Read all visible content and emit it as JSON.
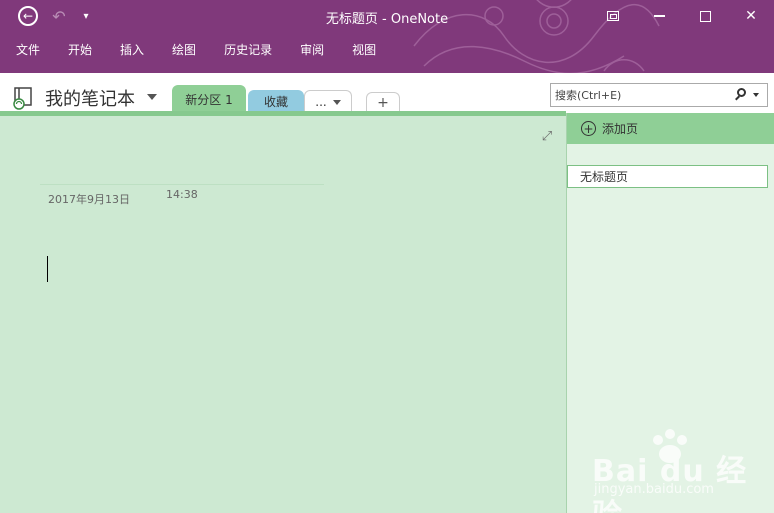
{
  "window": {
    "title": "无标题页 - OneNote"
  },
  "ribbon": {
    "menus": [
      "文件",
      "开始",
      "插入",
      "绘图",
      "历史记录",
      "审阅",
      "视图"
    ]
  },
  "notebook": {
    "name": "我的笔记本",
    "tabs": [
      {
        "label": "新分区 1"
      },
      {
        "label": "收藏"
      },
      {
        "label": "..."
      },
      {
        "label": "+"
      }
    ]
  },
  "search": {
    "placeholder": "搜索(Ctrl+E)"
  },
  "page": {
    "date": "2017年9月13日",
    "time": "14:38"
  },
  "pages_pane": {
    "add_page_label": "添加页",
    "pages": [
      {
        "title": "无标题页"
      }
    ]
  },
  "watermark": {
    "brand": "Bai du 经验",
    "url": "jingyan.baidu.com"
  },
  "colors": {
    "titlebar": "#80397b",
    "section_tab": "#8fcf96",
    "favorites_tab": "#92cbe0",
    "canvas": "#cde9d2"
  }
}
